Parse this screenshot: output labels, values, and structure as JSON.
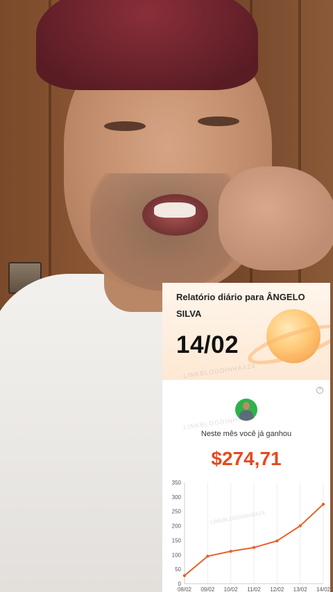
{
  "report": {
    "title": "Relatório diário para ÂNGELO SILVA",
    "date": "14/02",
    "month_label": "Neste mês você já ganhou",
    "amount": "$274,71",
    "watermark": "LINKBLOGDINHAX24"
  },
  "colors": {
    "accent": "#e8491f",
    "line": "#e8612c",
    "avatar_bg": "#2fb24a"
  },
  "icons": {
    "help": "help-icon",
    "avatar": "avatar"
  },
  "chart_data": {
    "type": "line",
    "x": [
      "08/02",
      "09/02",
      "10/02",
      "11/02",
      "12/02",
      "13/02",
      "14/02"
    ],
    "series": [
      {
        "values": [
          28,
          95,
          112,
          125,
          148,
          200,
          274.71
        ]
      }
    ],
    "ylim": [
      0,
      350
    ],
    "yticks": [
      0,
      50,
      100,
      150,
      200,
      250,
      300,
      350
    ],
    "grid": "vertical",
    "title": "",
    "xlabel": "",
    "ylabel": ""
  }
}
